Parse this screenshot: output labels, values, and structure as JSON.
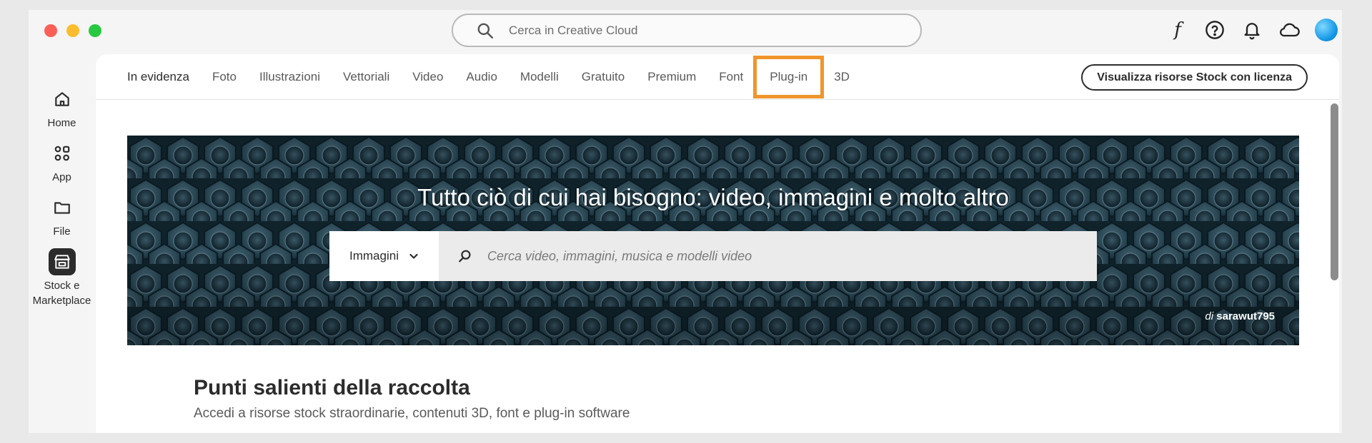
{
  "titlebar": {
    "search_placeholder": "Cerca in Creative Cloud",
    "icons": [
      "fonts-f-icon",
      "help-icon",
      "bell-icon",
      "cloud-icon",
      "avatar"
    ],
    "fonts_glyph": "f"
  },
  "rail": {
    "items": [
      {
        "label": "Home",
        "icon": "home-icon"
      },
      {
        "label": "App",
        "icon": "apps-grid-icon"
      },
      {
        "label": "File",
        "icon": "folder-icon"
      },
      {
        "label": "Stock e Marketplace",
        "icon": "storefront-icon",
        "active": true
      }
    ]
  },
  "tabs": {
    "items": [
      "In evidenza",
      "Foto",
      "Illustrazioni",
      "Vettoriali",
      "Video",
      "Audio",
      "Modelli",
      "Gratuito",
      "Premium",
      "Font",
      "Plug-in",
      "3D"
    ],
    "active": "In evidenza",
    "highlighted": "Plug-in"
  },
  "stock_button": {
    "label": "Visualizza risorse Stock con licenza"
  },
  "hero": {
    "title": "Tutto ciò di cui hai bisogno: video, immagini e molto altro",
    "search_type": "Immagini",
    "search_placeholder": "Cerca video, immagini, musica e modelli video",
    "credit_prefix": "di",
    "credit_author": "sarawut795"
  },
  "section": {
    "title": "Punti salienti della raccolta",
    "subtitle": "Accedi a risorse stock straordinarie, contenuti 3D, font e plug-in software"
  },
  "colors": {
    "highlight": "#f0952b",
    "hero_bg": "#1b3340",
    "accent_avatar": "#1296e6"
  }
}
